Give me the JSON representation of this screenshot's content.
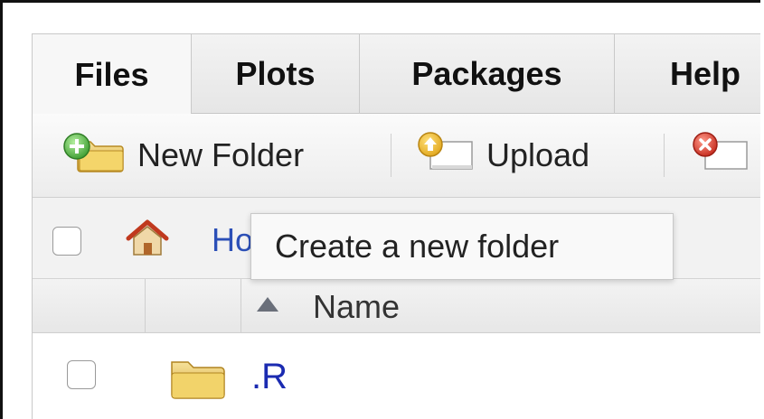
{
  "tabs": [
    {
      "label": "Files",
      "active": true
    },
    {
      "label": "Plots",
      "active": false
    },
    {
      "label": "Packages",
      "active": false
    },
    {
      "label": "Help",
      "active": false
    }
  ],
  "toolbar": {
    "new_folder_label": "New Folder",
    "upload_label": "Upload"
  },
  "path": {
    "home_label": "Ho"
  },
  "table": {
    "name_header": "Name",
    "sort_direction": "ascending",
    "rows": [
      {
        "name": ".R",
        "type": "folder"
      }
    ]
  },
  "tooltip": {
    "text": "Create a new folder"
  },
  "icons": {
    "new_folder": "folder-plus-icon",
    "upload": "upload-icon",
    "delete": "delete-icon",
    "home": "home-icon",
    "folder": "folder-icon"
  },
  "colors": {
    "link_blue": "#2b4fb7",
    "file_blue": "#1b2bb1"
  }
}
